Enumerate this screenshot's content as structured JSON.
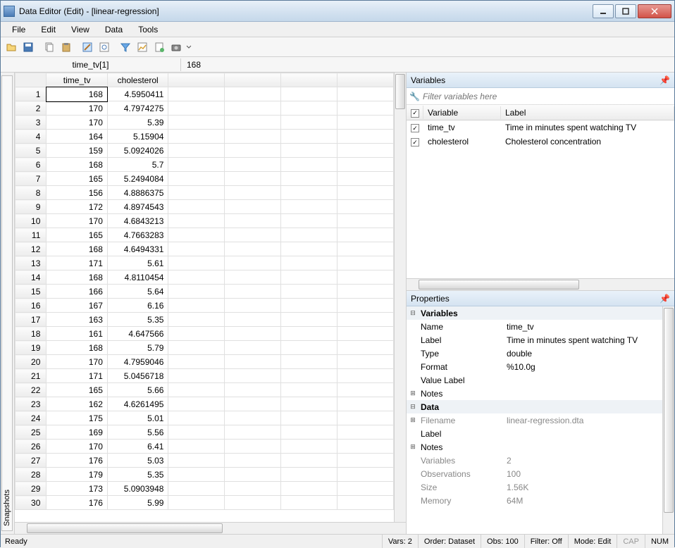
{
  "window": {
    "title": "Data Editor (Edit) - [linear-regression]"
  },
  "menu": {
    "items": [
      "File",
      "Edit",
      "View",
      "Data",
      "Tools"
    ]
  },
  "cellbar": {
    "ref": "time_tv[1]",
    "value": "168"
  },
  "snapshots_tab": "Snapshots",
  "grid": {
    "columns": [
      "time_tv",
      "cholesterol"
    ],
    "rows": [
      {
        "n": 1,
        "time_tv": "168",
        "cholesterol": "4.5950411"
      },
      {
        "n": 2,
        "time_tv": "170",
        "cholesterol": "4.7974275"
      },
      {
        "n": 3,
        "time_tv": "170",
        "cholesterol": "5.39"
      },
      {
        "n": 4,
        "time_tv": "164",
        "cholesterol": "5.15904"
      },
      {
        "n": 5,
        "time_tv": "159",
        "cholesterol": "5.0924026"
      },
      {
        "n": 6,
        "time_tv": "168",
        "cholesterol": "5.7"
      },
      {
        "n": 7,
        "time_tv": "165",
        "cholesterol": "5.2494084"
      },
      {
        "n": 8,
        "time_tv": "156",
        "cholesterol": "4.8886375"
      },
      {
        "n": 9,
        "time_tv": "172",
        "cholesterol": "4.8974543"
      },
      {
        "n": 10,
        "time_tv": "170",
        "cholesterol": "4.6843213"
      },
      {
        "n": 11,
        "time_tv": "165",
        "cholesterol": "4.7663283"
      },
      {
        "n": 12,
        "time_tv": "168",
        "cholesterol": "4.6494331"
      },
      {
        "n": 13,
        "time_tv": "171",
        "cholesterol": "5.61"
      },
      {
        "n": 14,
        "time_tv": "168",
        "cholesterol": "4.8110454"
      },
      {
        "n": 15,
        "time_tv": "166",
        "cholesterol": "5.64"
      },
      {
        "n": 16,
        "time_tv": "167",
        "cholesterol": "6.16"
      },
      {
        "n": 17,
        "time_tv": "163",
        "cholesterol": "5.35"
      },
      {
        "n": 18,
        "time_tv": "161",
        "cholesterol": "4.647566"
      },
      {
        "n": 19,
        "time_tv": "168",
        "cholesterol": "5.79"
      },
      {
        "n": 20,
        "time_tv": "170",
        "cholesterol": "4.7959046"
      },
      {
        "n": 21,
        "time_tv": "171",
        "cholesterol": "5.0456718"
      },
      {
        "n": 22,
        "time_tv": "165",
        "cholesterol": "5.66"
      },
      {
        "n": 23,
        "time_tv": "162",
        "cholesterol": "4.6261495"
      },
      {
        "n": 24,
        "time_tv": "175",
        "cholesterol": "5.01"
      },
      {
        "n": 25,
        "time_tv": "169",
        "cholesterol": "5.56"
      },
      {
        "n": 26,
        "time_tv": "170",
        "cholesterol": "6.41"
      },
      {
        "n": 27,
        "time_tv": "176",
        "cholesterol": "5.03"
      },
      {
        "n": 28,
        "time_tv": "179",
        "cholesterol": "5.35"
      },
      {
        "n": 29,
        "time_tv": "173",
        "cholesterol": "5.0903948"
      },
      {
        "n": 30,
        "time_tv": "176",
        "cholesterol": "5.99"
      }
    ]
  },
  "variables_panel": {
    "title": "Variables",
    "filter_placeholder": "Filter variables here",
    "head_variable": "Variable",
    "head_label": "Label",
    "rows": [
      {
        "name": "time_tv",
        "label": "Time in minutes spent watching TV"
      },
      {
        "name": "cholesterol",
        "label": "Cholesterol concentration"
      }
    ]
  },
  "properties_panel": {
    "title": "Properties",
    "sections": {
      "variables": {
        "title": "Variables",
        "rows": [
          {
            "key": "Name",
            "val": "time_tv"
          },
          {
            "key": "Label",
            "val": "Time in minutes spent watching TV"
          },
          {
            "key": "Type",
            "val": "double"
          },
          {
            "key": "Format",
            "val": "%10.0g"
          },
          {
            "key": "Value Label",
            "val": ""
          },
          {
            "key": "Notes",
            "val": "",
            "expand": true
          }
        ]
      },
      "data": {
        "title": "Data",
        "rows": [
          {
            "key": "Filename",
            "val": "linear-regression.dta",
            "expand": true,
            "disabled": true
          },
          {
            "key": "Label",
            "val": ""
          },
          {
            "key": "Notes",
            "val": "",
            "expand": true
          },
          {
            "key": "Variables",
            "val": "2",
            "disabled": true
          },
          {
            "key": "Observations",
            "val": "100",
            "disabled": true
          },
          {
            "key": "Size",
            "val": "1.56K",
            "disabled": true
          },
          {
            "key": "Memory",
            "val": "64M",
            "disabled": true
          }
        ]
      }
    }
  },
  "statusbar": {
    "ready": "Ready",
    "vars": "Vars: 2",
    "order": "Order: Dataset",
    "obs": "Obs: 100",
    "filter": "Filter: Off",
    "mode": "Mode: Edit",
    "cap": "CAP",
    "num": "NUM"
  }
}
